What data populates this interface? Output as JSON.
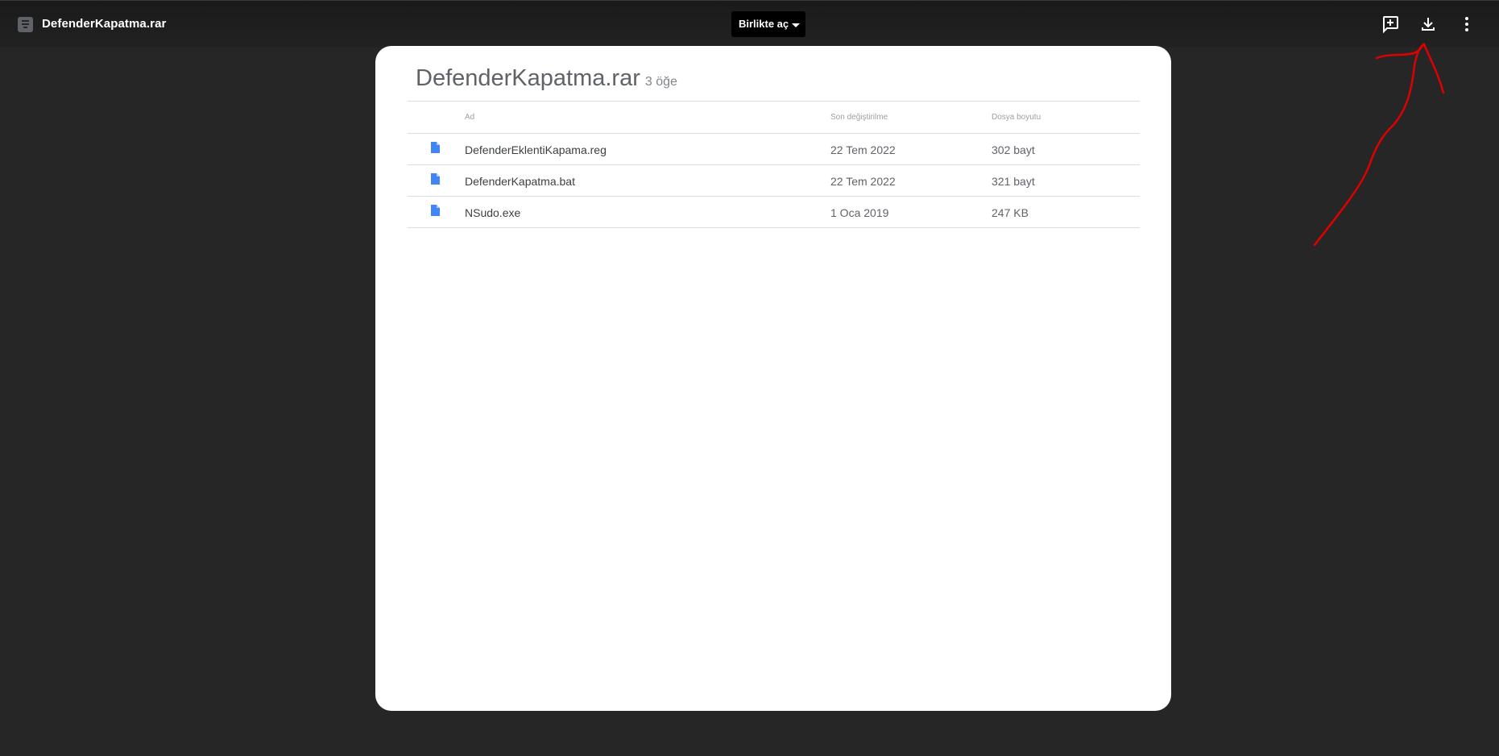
{
  "topbar": {
    "title": "DefenderKapatma.rar",
    "open_with_label": "Birlikte aç",
    "icons": {
      "file": "archive-file-icon",
      "add_comment": "add-comment-icon",
      "download": "download-icon",
      "more": "more-vert-icon"
    }
  },
  "archive": {
    "title": "DefenderKapatma.rar",
    "item_count": "3 öğe",
    "columns": {
      "name": "Ad",
      "modified": "Son değiştirilme",
      "size": "Dosya boyutu"
    },
    "rows": [
      {
        "name": "DefenderEklentiKapama.reg",
        "modified": "22 Tem 2022",
        "size": "302 bayt"
      },
      {
        "name": "DefenderKapatma.bat",
        "modified": "22 Tem 2022",
        "size": "321 bayt"
      },
      {
        "name": "NSudo.exe",
        "modified": "1 Oca 2019",
        "size": "247 KB"
      }
    ]
  },
  "colors": {
    "background": "#262626",
    "topbar": "#1a1a1a",
    "card": "#ffffff",
    "doc_icon": "#4285f4",
    "annotation": "#e00000"
  }
}
